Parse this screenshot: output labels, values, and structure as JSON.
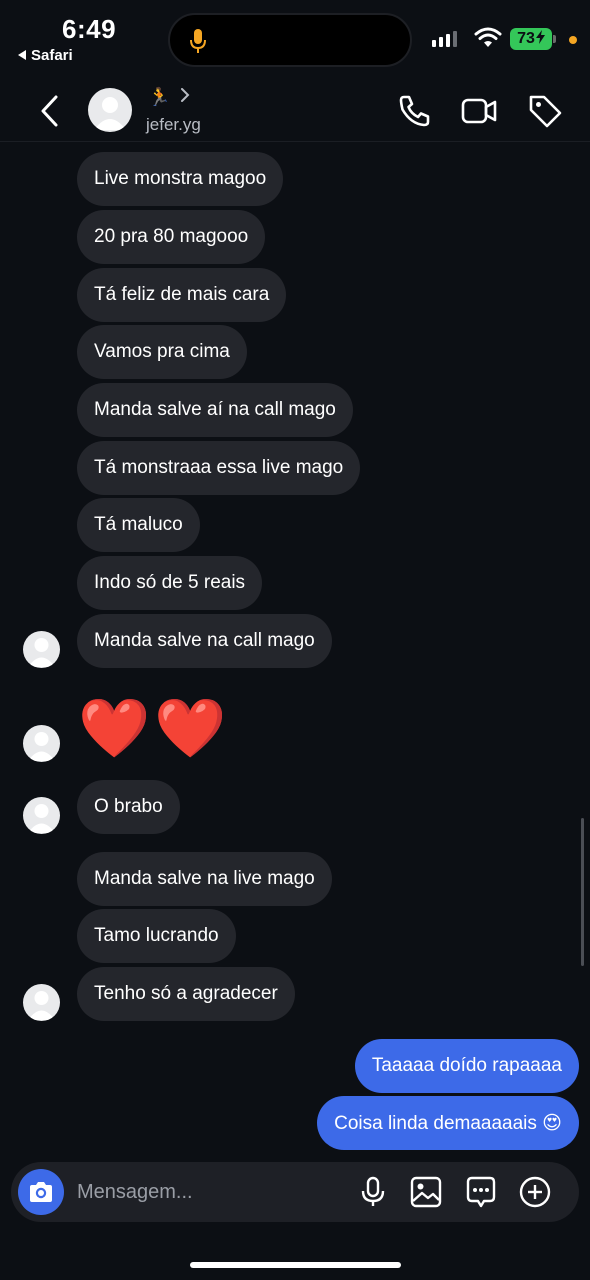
{
  "status_bar": {
    "time": "6:49",
    "back_app": "Safari",
    "battery": "73"
  },
  "header": {
    "status_emoji": "🏃",
    "username": "jefer.yg"
  },
  "messages": [
    {
      "text": "Live monstra magoo",
      "side": "received"
    },
    {
      "text": "20 pra 80 magooo",
      "side": "received"
    },
    {
      "text": "Tá feliz de mais cara",
      "side": "received"
    },
    {
      "text": "Vamos pra cima",
      "side": "received"
    },
    {
      "text": "Manda salve aí na call mago",
      "side": "received"
    },
    {
      "text": "Tá monstraaa essa live mago",
      "side": "received"
    },
    {
      "text": "Tá maluco",
      "side": "received"
    },
    {
      "text": "Indo só de 5 reais",
      "side": "received"
    },
    {
      "text": "Manda salve na call mago",
      "side": "received"
    },
    {
      "text": "❤️❤️",
      "side": "received"
    },
    {
      "text": "O brabo",
      "side": "received"
    },
    {
      "text": "Manda salve na live mago",
      "side": "received"
    },
    {
      "text": "Tamo lucrando",
      "side": "received"
    },
    {
      "text": "Tenho só a agradecer",
      "side": "received"
    },
    {
      "text": "Taaaaa doído rapaaaa",
      "side": "sent"
    },
    {
      "text": "Coisa linda demaaaaais 😍",
      "side": "sent"
    }
  ],
  "composer": {
    "placeholder": "Mensagem..."
  },
  "icons": {
    "back": "chevron-left-icon",
    "call": "phone-icon",
    "video": "video-camera-icon",
    "tag": "tag-icon",
    "camera": "camera-icon",
    "mic": "microphone-icon",
    "gallery": "image-icon",
    "sticker": "chat-sticker-icon",
    "add": "plus-circle-icon"
  },
  "colors": {
    "background": "#0c0f14",
    "received_bubble": "#24262c",
    "sent_bubble": "#3d6ae8",
    "battery": "#34c759"
  }
}
